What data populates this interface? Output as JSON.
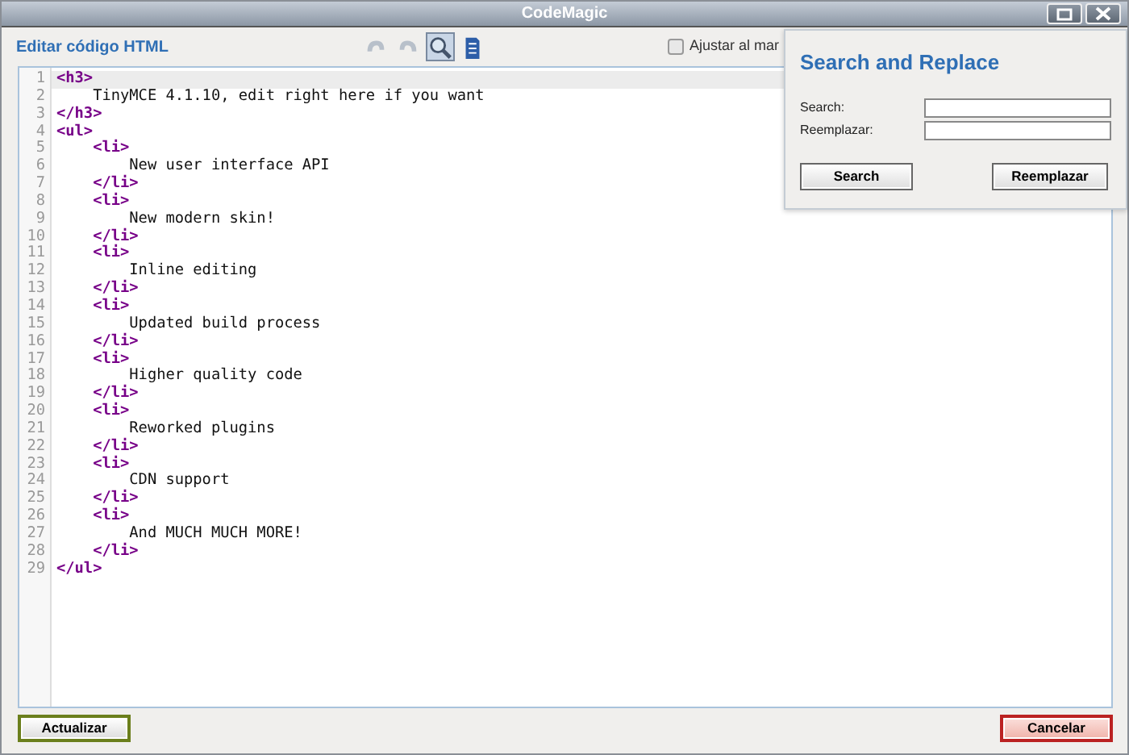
{
  "window": {
    "title": "CodeMagic"
  },
  "toolbar": {
    "title": "Editar código HTML",
    "buttons": [
      {
        "kind": "undo",
        "disabled": true,
        "selected": false
      },
      {
        "kind": "redo",
        "disabled": true,
        "selected": false
      },
      {
        "kind": "search",
        "disabled": false,
        "selected": true
      },
      {
        "kind": "document",
        "disabled": false,
        "selected": false
      }
    ],
    "wrap": {
      "label": "Ajustar al mar",
      "checked": false
    }
  },
  "editor": {
    "lines": [
      {
        "number": "1",
        "kind": "tag",
        "text": "<h3>",
        "active": true
      },
      {
        "number": "2",
        "kind": "text",
        "text": "    TinyMCE 4.1.10, edit right here if you want",
        "active": false
      },
      {
        "number": "3",
        "kind": "tag",
        "text": "</h3>",
        "active": false
      },
      {
        "number": "4",
        "kind": "tag",
        "text": "<ul>",
        "active": false
      },
      {
        "number": "5",
        "kind": "tag",
        "text": "    <li>",
        "active": false
      },
      {
        "number": "6",
        "kind": "text",
        "text": "        New user interface API",
        "active": false
      },
      {
        "number": "7",
        "kind": "tag",
        "text": "    </li>",
        "active": false
      },
      {
        "number": "8",
        "kind": "tag",
        "text": "    <li>",
        "active": false
      },
      {
        "number": "9",
        "kind": "text",
        "text": "        New modern skin!",
        "active": false
      },
      {
        "number": "10",
        "kind": "tag",
        "text": "    </li>",
        "active": false
      },
      {
        "number": "11",
        "kind": "tag",
        "text": "    <li>",
        "active": false
      },
      {
        "number": "12",
        "kind": "text",
        "text": "        Inline editing",
        "active": false
      },
      {
        "number": "13",
        "kind": "tag",
        "text": "    </li>",
        "active": false
      },
      {
        "number": "14",
        "kind": "tag",
        "text": "    <li>",
        "active": false
      },
      {
        "number": "15",
        "kind": "text",
        "text": "        Updated build process",
        "active": false
      },
      {
        "number": "16",
        "kind": "tag",
        "text": "    </li>",
        "active": false
      },
      {
        "number": "17",
        "kind": "tag",
        "text": "    <li>",
        "active": false
      },
      {
        "number": "18",
        "kind": "text",
        "text": "        Higher quality code",
        "active": false
      },
      {
        "number": "19",
        "kind": "tag",
        "text": "    </li>",
        "active": false
      },
      {
        "number": "20",
        "kind": "tag",
        "text": "    <li>",
        "active": false
      },
      {
        "number": "21",
        "kind": "text",
        "text": "        Reworked plugins",
        "active": false
      },
      {
        "number": "22",
        "kind": "tag",
        "text": "    </li>",
        "active": false
      },
      {
        "number": "23",
        "kind": "tag",
        "text": "    <li>",
        "active": false
      },
      {
        "number": "24",
        "kind": "text",
        "text": "        CDN support",
        "active": false
      },
      {
        "number": "25",
        "kind": "tag",
        "text": "    </li>",
        "active": false
      },
      {
        "number": "26",
        "kind": "tag",
        "text": "    <li>",
        "active": false
      },
      {
        "number": "27",
        "kind": "text",
        "text": "        And MUCH MUCH MORE!",
        "active": false
      },
      {
        "number": "28",
        "kind": "tag",
        "text": "    </li>",
        "active": false
      },
      {
        "number": "29",
        "kind": "tag",
        "text": "</ul>",
        "active": false
      }
    ]
  },
  "search_panel": {
    "title": "Search and Replace",
    "fields": [
      {
        "label": "Search:"
      },
      {
        "label": "Reemplazar:"
      }
    ],
    "buttons": [
      "Search",
      "Reemplazar"
    ]
  },
  "footer": {
    "buttons": [
      {
        "label": "Actualizar",
        "kind": "confirm"
      },
      {
        "label": "Cancelar",
        "kind": "cancel"
      }
    ]
  }
}
